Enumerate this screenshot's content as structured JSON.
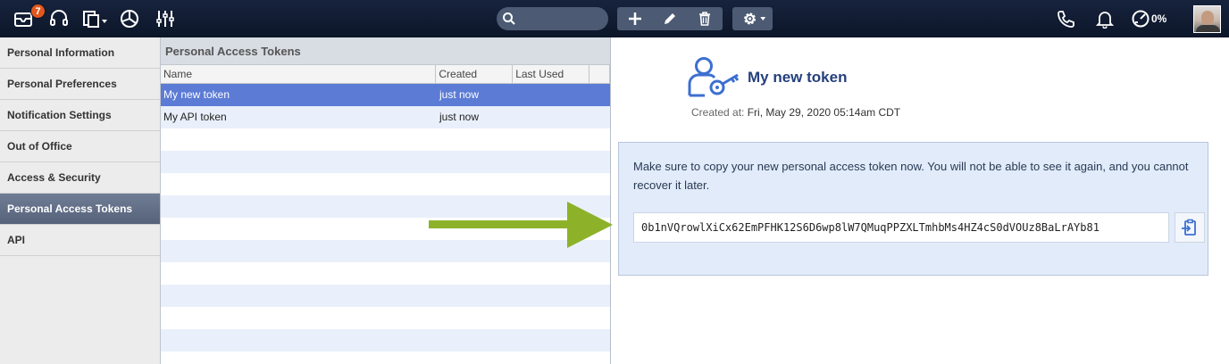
{
  "topbar": {
    "mail_badge": "7",
    "performance_label": "0%",
    "icons": [
      "mail-icon",
      "headset-icon",
      "documents-icon",
      "chart-icon",
      "sliders-icon",
      "search-icon",
      "add-icon",
      "pencil-icon",
      "trash-icon",
      "gear-icon",
      "phone-icon",
      "bell-icon",
      "performance-icon"
    ]
  },
  "leftnav": {
    "items": [
      {
        "label": "Personal Information"
      },
      {
        "label": "Personal Preferences"
      },
      {
        "label": "Notification Settings"
      },
      {
        "label": "Out of Office"
      },
      {
        "label": "Access & Security"
      },
      {
        "label": "Personal Access Tokens",
        "active": true
      },
      {
        "label": "API"
      }
    ]
  },
  "tokens": {
    "title": "Personal Access Tokens",
    "columns": [
      "Name",
      "Created",
      "Last Used"
    ],
    "rows": [
      {
        "name": "My new token",
        "created": "just now",
        "last_used": "",
        "selected": true
      },
      {
        "name": "My API token",
        "created": "just now",
        "last_used": ""
      }
    ]
  },
  "detail": {
    "token_name": "My new token",
    "created_label": "Created at:",
    "created_value": "Fri, May 29, 2020 05:14am CDT",
    "notice": "Make sure to copy your new personal access token now. You will not be able to see it again, and you cannot recover it later.",
    "token_value": "0b1nVQrowlXiCx62EmPFHK12S6D6wp8lW7QMuqPPZXLTmhbMs4HZ4cS0dVOUz8BaLrAYb81"
  },
  "colors": {
    "topbar": "#0c1629",
    "selected_row": "#5b7bd5",
    "arrow": "#8db22a",
    "accent_title": "#25407d"
  }
}
